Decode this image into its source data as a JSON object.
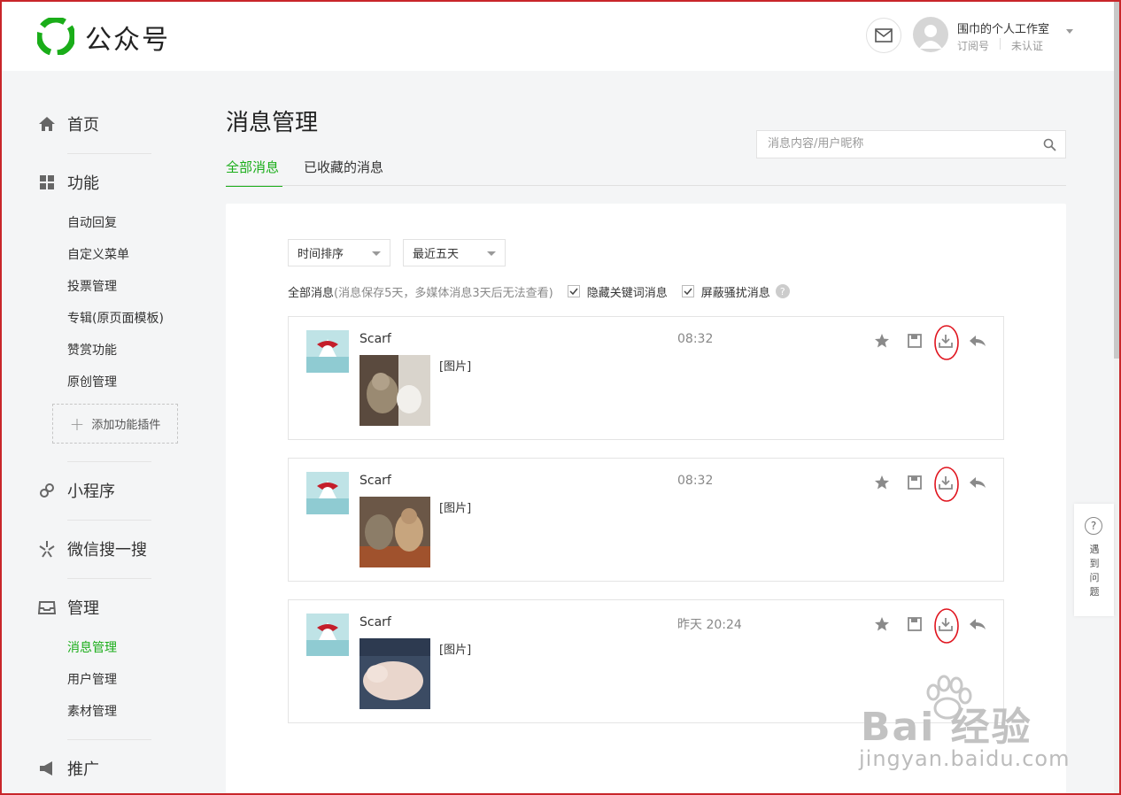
{
  "brand": {
    "name": "公众号",
    "color": "#1aad19"
  },
  "header": {
    "mail_icon": "envelope-icon",
    "account_name": "围巾的个人工作室",
    "account_type": "订阅号",
    "account_auth": "未认证"
  },
  "sidebar": {
    "home": {
      "label": "首页",
      "icon": "home-icon"
    },
    "features": {
      "label": "功能",
      "icon": "grid-icon",
      "items": [
        "自动回复",
        "自定义菜单",
        "投票管理",
        "专辑(原页面模板)",
        "赞赏功能",
        "原创管理"
      ],
      "add_plugin": "添加功能插件"
    },
    "mini_program": {
      "label": "小程序",
      "icon": "link-icon"
    },
    "search": {
      "label": "微信搜一搜",
      "icon": "sparkle-icon"
    },
    "manage": {
      "label": "管理",
      "icon": "inbox-icon",
      "items": [
        "消息管理",
        "用户管理",
        "素材管理"
      ],
      "active_index": 0
    },
    "promote": {
      "label": "推广",
      "icon": "megaphone-icon"
    }
  },
  "main": {
    "title": "消息管理",
    "search": {
      "placeholder": "消息内容/用户昵称"
    },
    "tabs": [
      "全部消息",
      "已收藏的消息"
    ],
    "active_tab": 0,
    "sort_dropdown": "时间排序",
    "range_dropdown": "最近五天",
    "filter": {
      "label": "全部消息",
      "note": "(消息保存5天，多媒体消息3天后无法查看)",
      "hide_keyword": "隐藏关键词消息",
      "block_spam": "屏蔽骚扰消息",
      "hide_keyword_checked": true,
      "block_spam_checked": true
    },
    "messages": [
      {
        "name": "Scarf",
        "time": "08:32",
        "tag": "[图片]"
      },
      {
        "name": "Scarf",
        "time": "08:32",
        "tag": "[图片]"
      },
      {
        "name": "Scarf",
        "time": "昨天 20:24",
        "tag": "[图片]"
      }
    ],
    "action_icons": [
      "star-icon",
      "save-icon",
      "download-icon",
      "reply-icon"
    ]
  },
  "help_float": {
    "text": "遇到问题"
  },
  "watermark": {
    "brand": "Bai 经验",
    "url": "jingyan.baidu.com"
  }
}
